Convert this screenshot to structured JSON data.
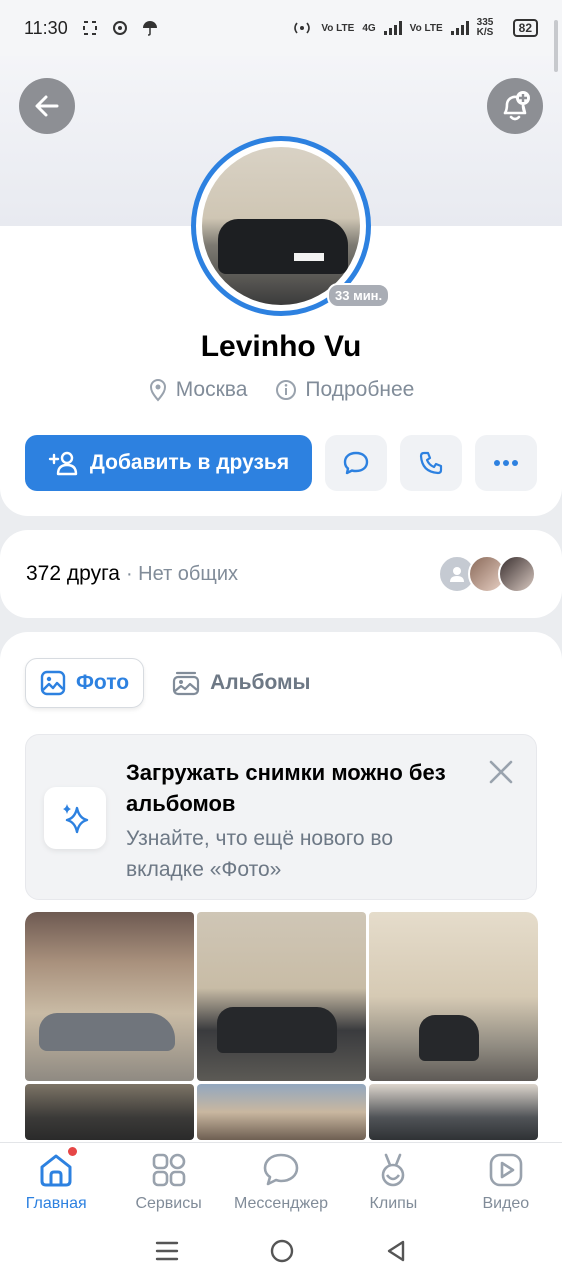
{
  "status_bar": {
    "time": "11:30",
    "volte1": "Vo LTE",
    "network": "4G",
    "volte2": "Vo LTE",
    "speed": "335 K/S",
    "battery": "82"
  },
  "profile": {
    "name": "Levinho Vu",
    "last_seen": "33 мин.",
    "location": "Москва",
    "details_label": "Подробнее",
    "add_friend_label": "Добавить в друзья"
  },
  "friends": {
    "count": "372 друга",
    "mutual": "· Нет общих"
  },
  "photos": {
    "tabs": [
      {
        "label": "Фото",
        "active": true
      },
      {
        "label": "Альбомы",
        "active": false
      }
    ],
    "promo": {
      "title": "Загружать снимки можно без альбомов",
      "text": "Узнайте, что ещё нового во вкладке «Фото»"
    }
  },
  "bottom_nav": [
    {
      "label": "Главная",
      "icon": "home-icon",
      "active": true
    },
    {
      "label": "Сервисы",
      "icon": "services-icon",
      "active": false
    },
    {
      "label": "Мессенджер",
      "icon": "messenger-icon",
      "active": false
    },
    {
      "label": "Клипы",
      "icon": "clips-icon",
      "active": false
    },
    {
      "label": "Видео",
      "icon": "video-icon",
      "active": false
    }
  ],
  "colors": {
    "accent": "#2d81e0",
    "notification_dot": "#e64646",
    "secondary_text": "#818c99"
  }
}
